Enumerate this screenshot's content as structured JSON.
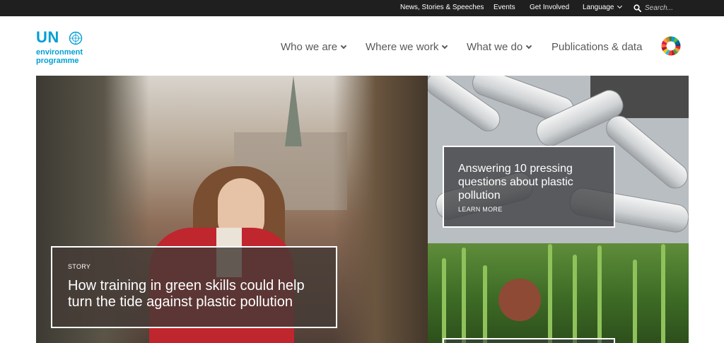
{
  "topbar": {
    "links": [
      {
        "label": "News, Stories & Speeches"
      },
      {
        "label": "Events"
      },
      {
        "label": "Get Involved"
      },
      {
        "label": "Language"
      }
    ],
    "search": {
      "placeholder": "Search..."
    }
  },
  "logo": {
    "un": "UN",
    "line1": "environment",
    "line2": "programme",
    "emblem": "un-emblem-icon"
  },
  "nav": {
    "items": [
      {
        "label": "Who we are"
      },
      {
        "label": "Where we work"
      },
      {
        "label": "What we do"
      },
      {
        "label": "Publications & data"
      }
    ],
    "sdg_icon": "sdg-wheel-icon"
  },
  "hero": {
    "main": {
      "kicker": "STORY",
      "title": "How training in green skills could help turn the tide against plastic pollution"
    },
    "top_right": {
      "title": "Answering 10 pressing questions about plastic pollution",
      "link": "LEARN MORE"
    }
  },
  "colors": {
    "topbar_bg": "#1f1f1f",
    "brand_blue": "#009fd4",
    "nav_text": "#595959",
    "coat_red": "#c0262d"
  }
}
